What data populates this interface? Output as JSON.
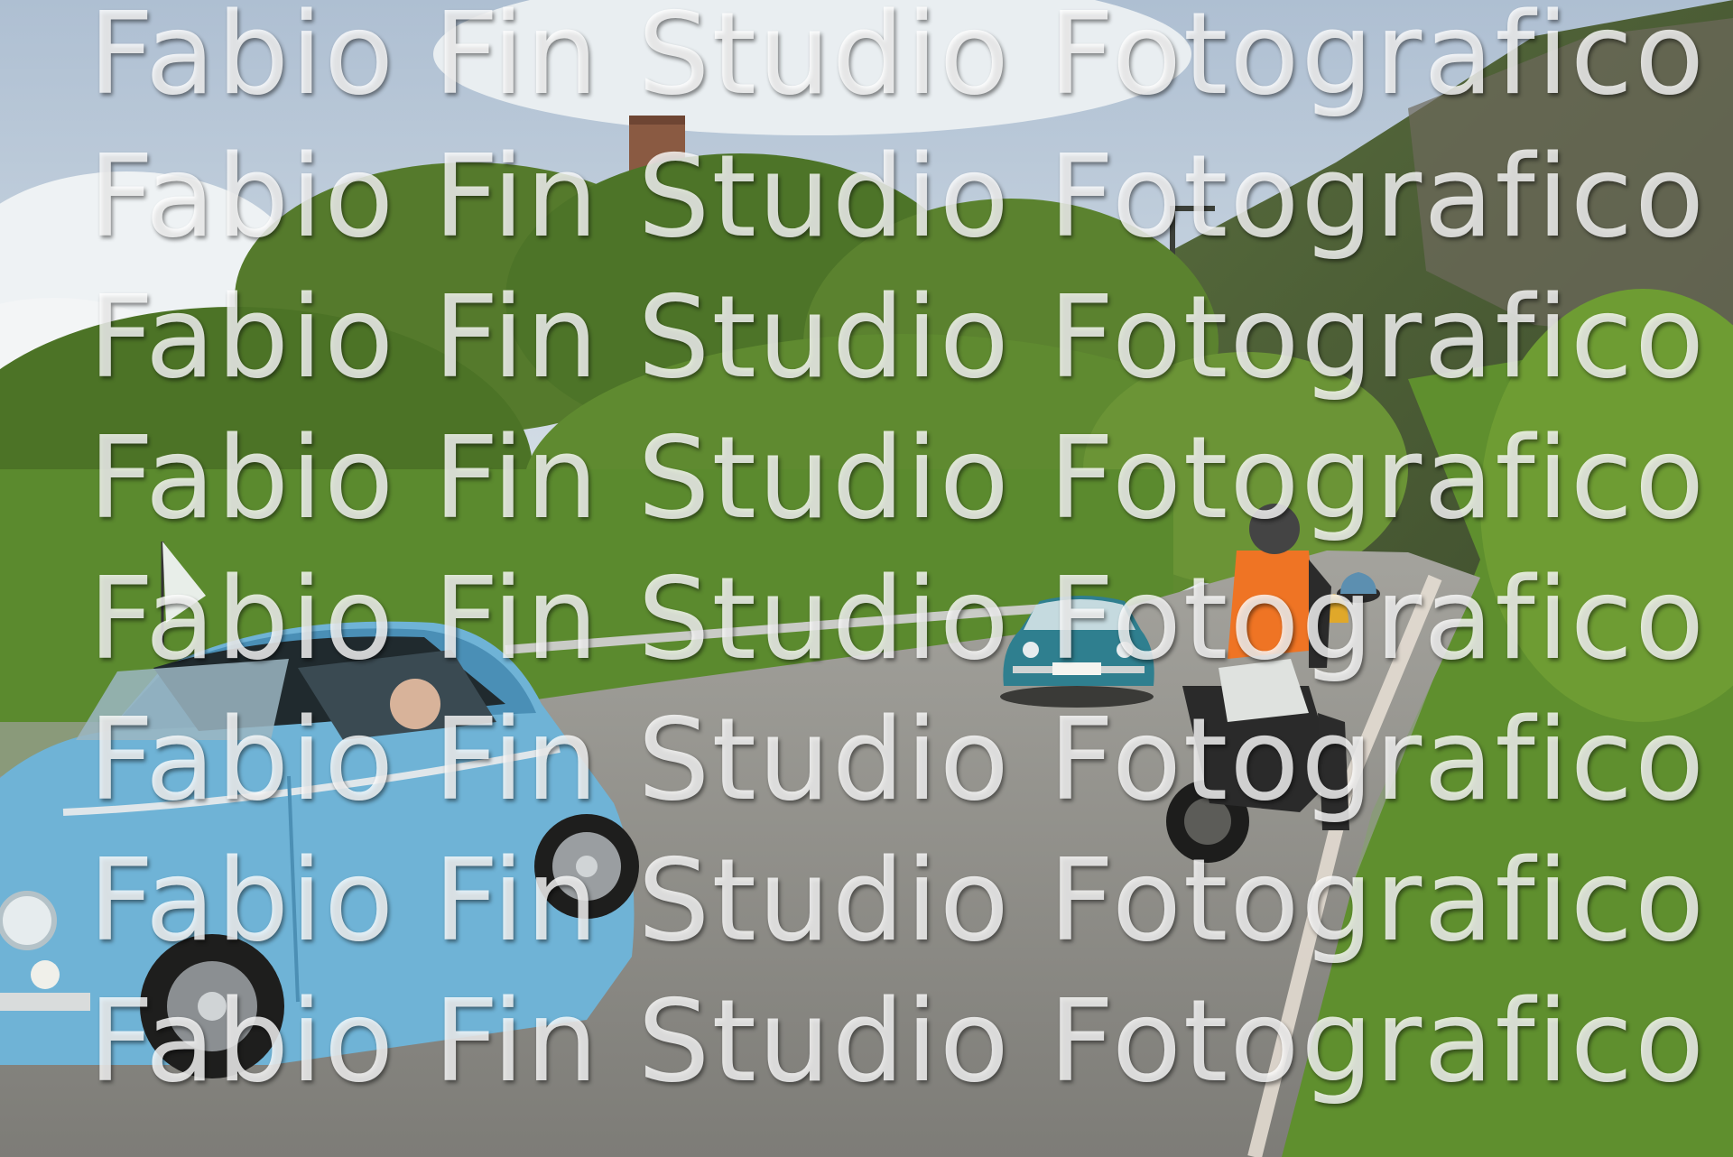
{
  "watermark": {
    "lines": [
      "Fabio Fin Studio Fotografico",
      "Fabio Fin Studio Fotografico",
      "Fabio Fin Studio Fotografico",
      "Fabio Fin Studio Fotografico",
      "Fabio Fin Studio Fotografico",
      "Fabio Fin Studio Fotografico",
      "Fabio Fin Studio Fotografico",
      "Fabio Fin Studio Fotografico"
    ]
  },
  "colors": {
    "sky": "#c9d8e6",
    "foliage": "#4f7a2a",
    "road": "#8d8d88",
    "car": "#6fb4d8",
    "vest": "#f07a2a"
  }
}
